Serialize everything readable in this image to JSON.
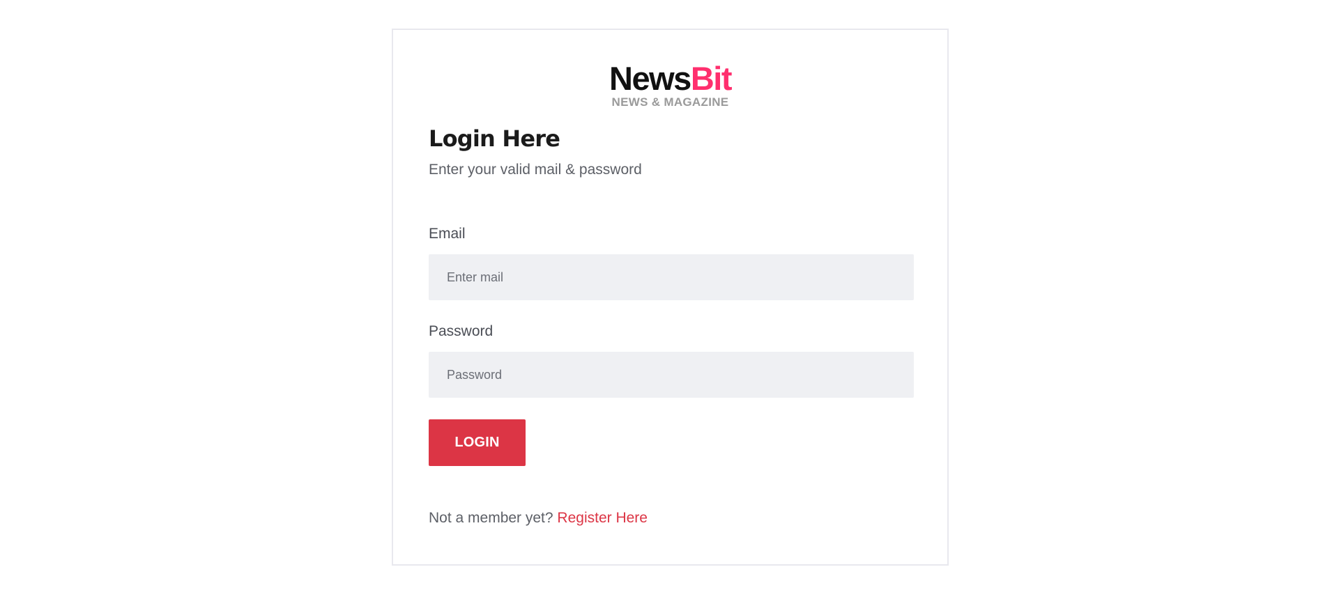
{
  "logo": {
    "brand_part1": "News",
    "brand_part2": "Bit",
    "tagline": "NEWS & MAGAZINE"
  },
  "login": {
    "title": "Login Here",
    "subtitle": "Enter your valid mail & password",
    "email": {
      "label": "Email",
      "placeholder": "Enter mail",
      "value": ""
    },
    "password": {
      "label": "Password",
      "placeholder": "Password",
      "value": ""
    },
    "submit_label": "LOGIN",
    "register_prompt": "Not a member yet?",
    "register_link": "Register Here"
  },
  "colors": {
    "brand_dark": "#111111",
    "brand_accent": "#ff2f6e",
    "button_bg": "#dc3545",
    "link": "#dc3545",
    "input_bg": "#eff0f3",
    "card_border": "#e8e8ee"
  }
}
